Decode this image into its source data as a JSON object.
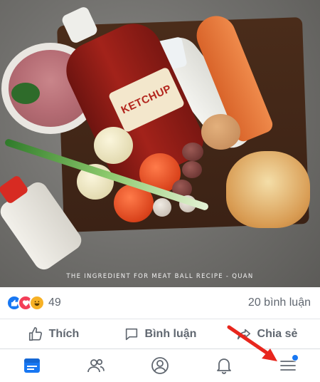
{
  "photo": {
    "caption": "THE INGREDIENT FOR MEAT BALL RECIPE - QUAN",
    "ketchup_label": "KETCHUP"
  },
  "reactions": {
    "icons": [
      "like-icon",
      "love-icon",
      "haha-icon"
    ],
    "count": "49",
    "comments": "20 bình luận"
  },
  "actions": {
    "like": "Thích",
    "comment": "Bình luận",
    "share": "Chia sẻ"
  },
  "bottom_nav": {
    "items": [
      "news-feed-icon",
      "friends-icon",
      "profile-icon",
      "notifications-icon",
      "menu-icon"
    ]
  },
  "colors": {
    "accent": "#1877f2",
    "text_secondary": "#606770",
    "annotation": "#e8261d"
  }
}
